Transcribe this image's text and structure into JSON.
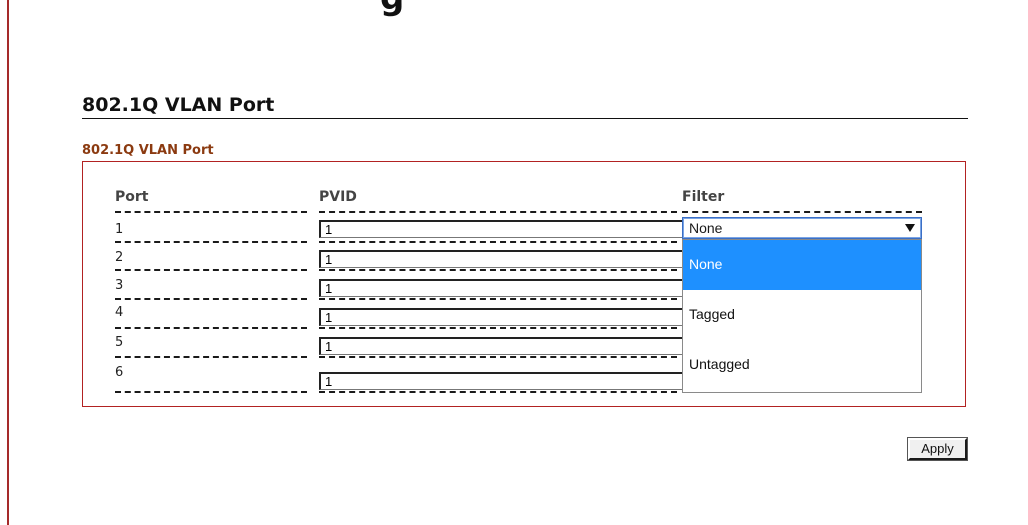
{
  "page": {
    "heading_fragment": "g",
    "title": "802.1Q VLAN Port",
    "section_title": "802.1Q VLAN Port"
  },
  "table": {
    "columns": [
      "Port",
      "PVID",
      "Filter"
    ],
    "rows": [
      {
        "port": "1",
        "pvid": "1"
      },
      {
        "port": "2",
        "pvid": "1"
      },
      {
        "port": "3",
        "pvid": "1"
      },
      {
        "port": "4",
        "pvid": "1"
      },
      {
        "port": "5",
        "pvid": "1"
      },
      {
        "port": "6",
        "pvid": "1"
      }
    ]
  },
  "filter": {
    "selected": "None",
    "options": [
      "None",
      "Tagged",
      "Untagged"
    ]
  },
  "actions": {
    "apply_label": "Apply"
  },
  "colors": {
    "accent_border": "#b22222",
    "section_title": "#8b3a10",
    "selected_option": "#1e90ff"
  }
}
